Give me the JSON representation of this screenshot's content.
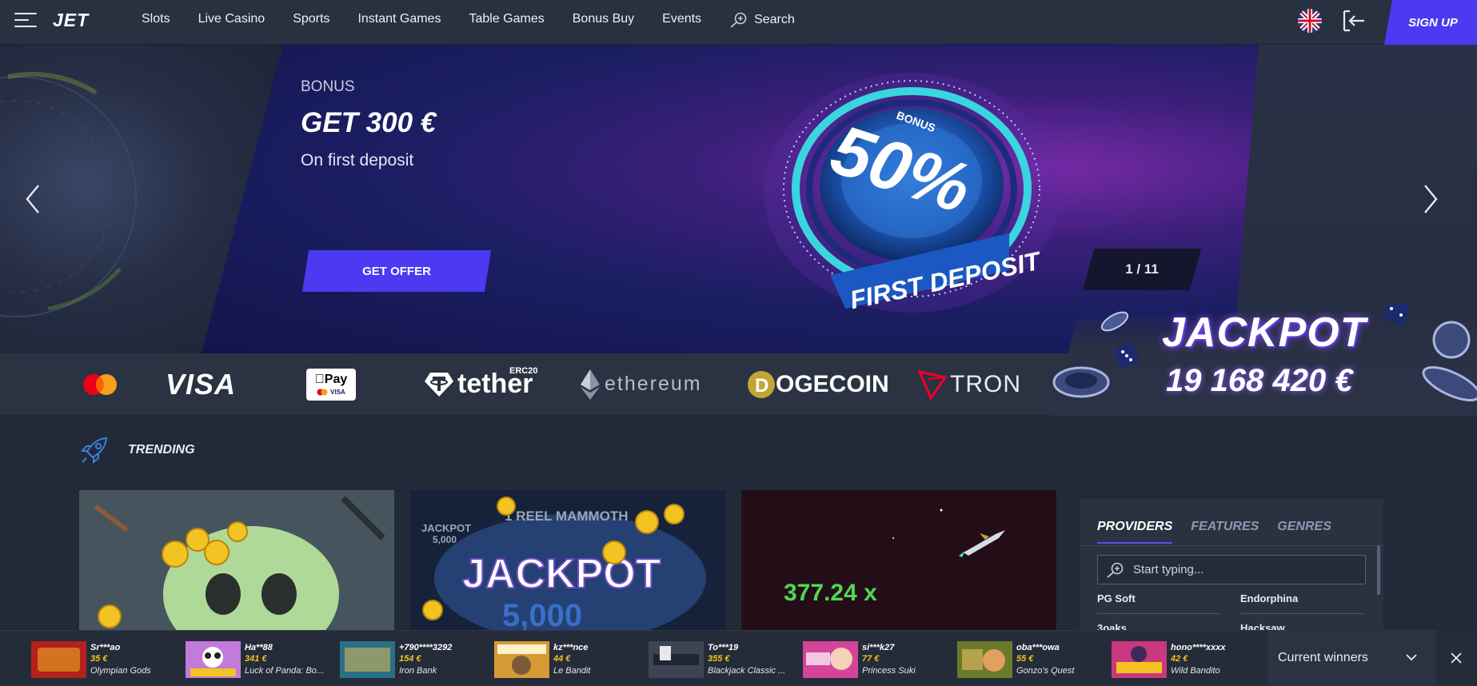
{
  "header": {
    "logo": "JET",
    "nav": [
      "Slots",
      "Live Casino",
      "Sports",
      "Instant Games",
      "Table Games",
      "Bonus Buy",
      "Events"
    ],
    "search_label": "Search",
    "signup_label": "SIGN UP"
  },
  "hero": {
    "tag": "BONUS",
    "title": "GET 300 €",
    "subtitle": "On first deposit",
    "cta_label": "GET OFFER",
    "slide_counter": "1 / 11",
    "badge_top": "BONUS",
    "badge_big": "50%",
    "badge_bottom": "FIRST DEPOSIT"
  },
  "payments": {
    "visa": "VISA",
    "applepay": "Pay",
    "applepay_visa": "VISA",
    "tether": "tether",
    "tether_erc": "ERC20",
    "ethereum": "ethereum",
    "dogecoin": "OGECOIN",
    "tron": "TRON"
  },
  "jackpot": {
    "title": "JACKPOT",
    "amount": "19 168 420 €"
  },
  "trending": {
    "label": "TRENDING",
    "tiles": [
      {
        "art_text": ""
      },
      {
        "art_title": "1 REEL MAMMOTH",
        "art_jp_small": "JACKPOT",
        "art_jp_small_value": "5,000",
        "art_big": "JACKPOT",
        "art_big_value": "5,000"
      },
      {
        "art_multiplier": "377.24 x"
      }
    ]
  },
  "filter_panel": {
    "tabs": [
      "PROVIDERS",
      "FEATURES",
      "GENRES"
    ],
    "active_tab": "PROVIDERS",
    "search_placeholder": "Start typing...",
    "items": [
      "PG Soft",
      "Endorphina",
      "3oaks",
      "Hacksaw"
    ]
  },
  "winners": {
    "toggle_label": "Current winners",
    "list": [
      {
        "user": "Sr***ao",
        "amount": "35 €",
        "game": "Olympian Gods",
        "color": "#b4211c"
      },
      {
        "user": "Ha**88",
        "amount": "341 €",
        "game": "Luck of Panda: Bo...",
        "color": "#c27bd8"
      },
      {
        "user": "+790****3292",
        "amount": "154 €",
        "game": "Iron Bank",
        "color": "#2a6f86"
      },
      {
        "user": "kz***nce",
        "amount": "44 €",
        "game": "Le Bandit",
        "color": "#d69a35"
      },
      {
        "user": "To***19",
        "amount": "355 €",
        "game": "Blackjack Classic ...",
        "color": "#3d4554"
      },
      {
        "user": "si***k27",
        "amount": "77 €",
        "game": "Princess Suki",
        "color": "#d3459a"
      },
      {
        "user": "oba***owa",
        "amount": "55 €",
        "game": "Gonzo's Quest",
        "color": "#6b7a2c"
      },
      {
        "user": "hono****xxxx",
        "amount": "42 €",
        "game": "Wild Bandito",
        "color": "#c9387e"
      }
    ]
  }
}
